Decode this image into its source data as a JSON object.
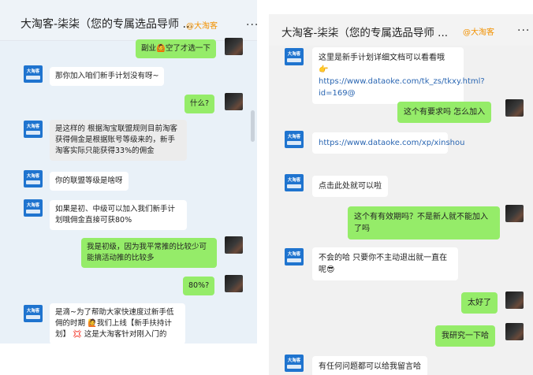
{
  "left": {
    "title": "大淘客-柒柒（您的专属选品导师 ...",
    "tag": "@大淘客",
    "more": "···",
    "avatar_label": "大淘客",
    "messages": [
      {
        "text": "副业🙆空了才选一下"
      },
      {
        "text": "那你加入咱们新手计划没有呀~"
      },
      {
        "text": "什么?"
      },
      {
        "text": "是这样的 根据淘宝联盟规则目前淘客获得佣金是根据账号等级来的，新手淘客实际只能获得33%的佣金"
      },
      {
        "text": "你的联盟等级是啥呀"
      },
      {
        "text": "如果是初、中级可以加入我们新手计划哦佣金直接可获80%"
      },
      {
        "text": "我是初级，因为我平常推的比较少可能搞活动推的比较多"
      },
      {
        "text": "80%?"
      },
      {
        "text": "是滴~为了帮助大家快速度过新手低佣的时期 🙋我们上线【新手扶持计划】 💢 这是大淘客针对刚入门的"
      }
    ]
  },
  "right": {
    "title": "大淘客-柒柒（您的专属选品导师 ...",
    "tag": "@大淘客",
    "more": "···",
    "avatar_label": "大淘客",
    "messages": [
      {
        "text": "这里是新手计划详细文档可以看看哦",
        "link": "👉https://www.dataoke.com/tk_zs/tkxy.html?id=169@"
      },
      {
        "text": "这个有要求吗 怎么加入"
      },
      {
        "link": "https://www.dataoke.com/xp/xinshou"
      },
      {
        "text": "点击此处就可以啦"
      },
      {
        "text": "这个有有效期吗？不是新人就不能加入了吗"
      },
      {
        "text": "不会的哈 只要你不主动退出就一直在呢😎"
      },
      {
        "text": "太好了"
      },
      {
        "text": "我研究一下哈"
      },
      {
        "text": "有任何问题都可以给我留言哈"
      }
    ]
  }
}
